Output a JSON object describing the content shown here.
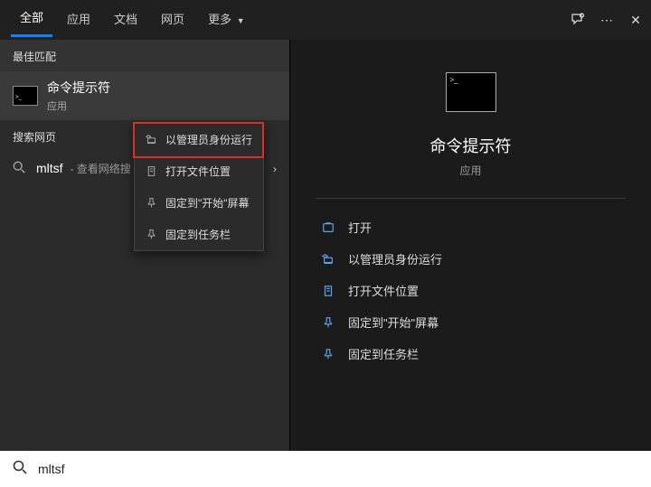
{
  "tabs": {
    "all": "全部",
    "apps": "应用",
    "docs": "文档",
    "web": "网页",
    "more": "更多"
  },
  "sections": {
    "best_match": "最佳匹配",
    "search_web": "搜索网页"
  },
  "result": {
    "title": "命令提示符",
    "subtitle": "应用"
  },
  "web_result": {
    "prefix": "mltsf",
    "suffix": "- 查看网络搜"
  },
  "context_menu": {
    "run_admin": "以管理员身份运行",
    "open_location": "打开文件位置",
    "pin_start": "固定到\"开始\"屏幕",
    "pin_taskbar": "固定到任务栏"
  },
  "preview": {
    "title": "命令提示符",
    "subtitle": "应用"
  },
  "actions": {
    "open": "打开",
    "run_admin": "以管理员身份运行",
    "open_location": "打开文件位置",
    "pin_start": "固定到\"开始\"屏幕",
    "pin_taskbar": "固定到任务栏"
  },
  "search": {
    "value": "mltsf"
  }
}
